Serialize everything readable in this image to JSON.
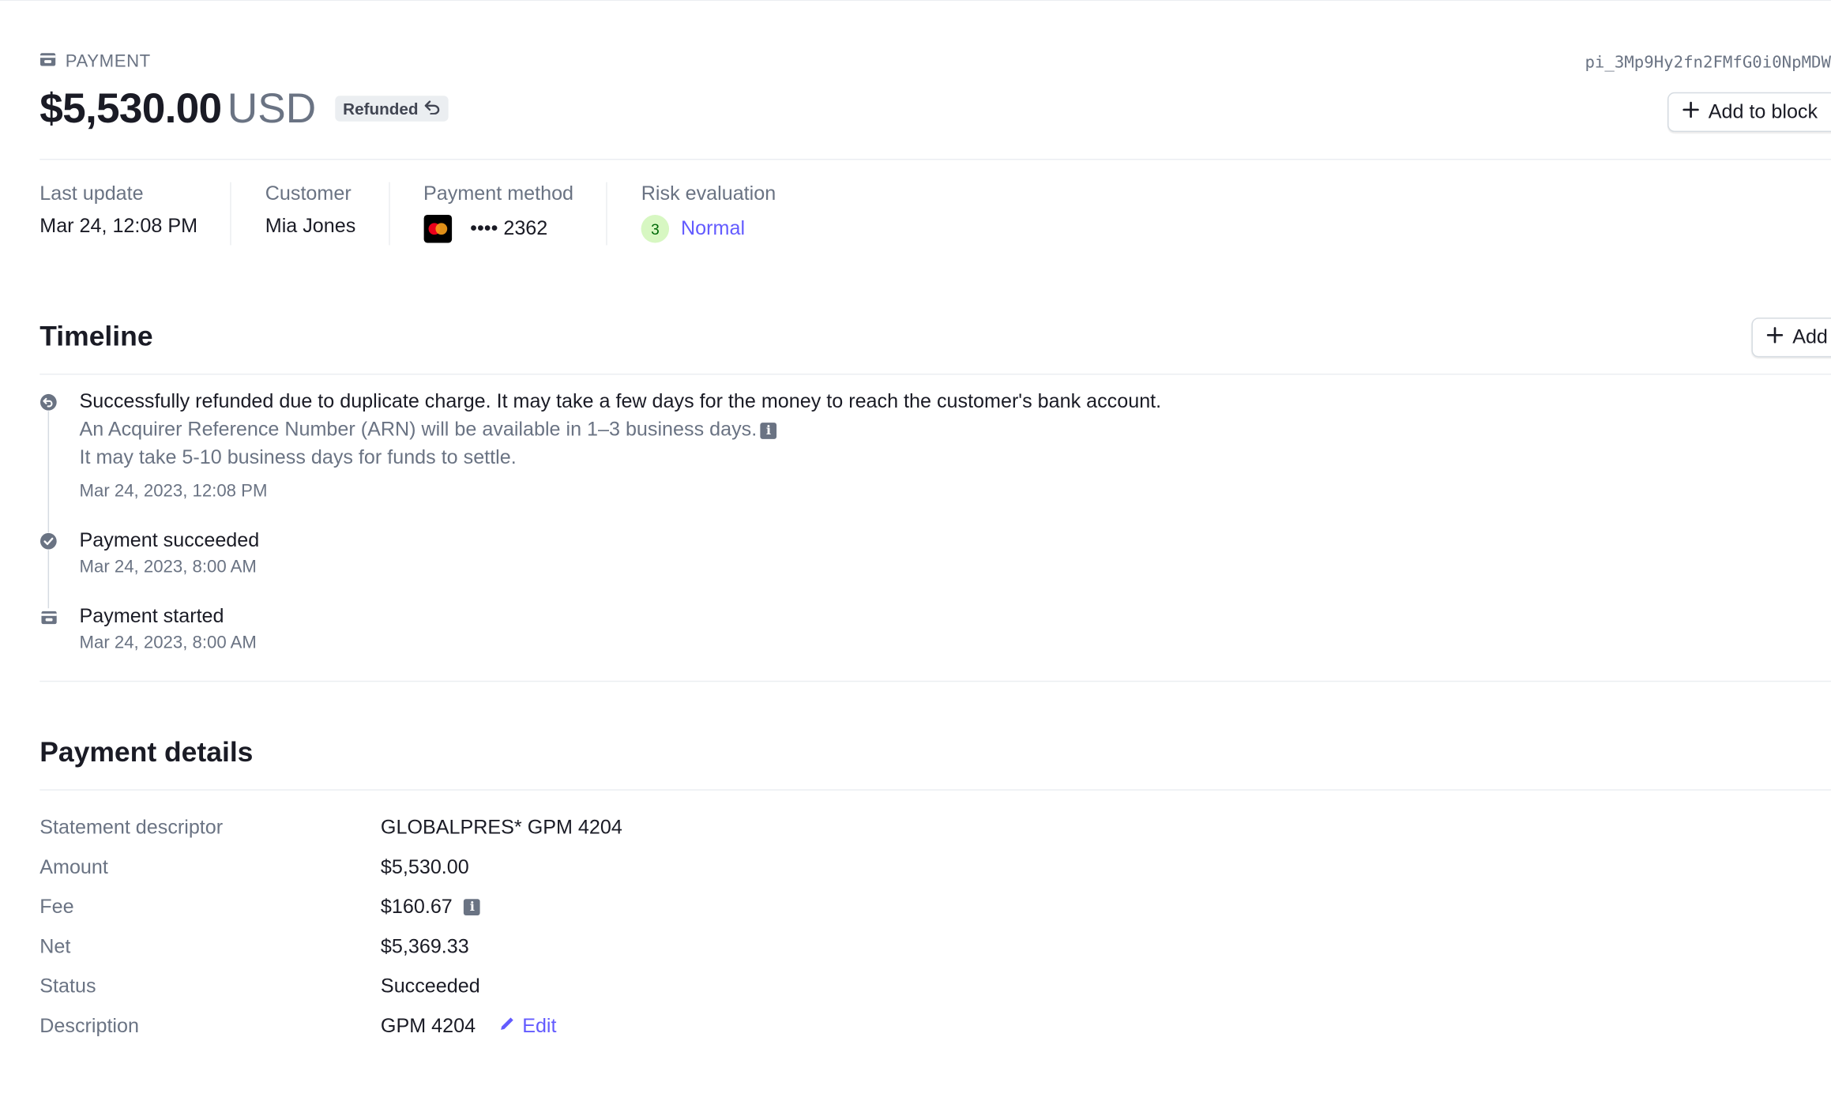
{
  "header": {
    "kicker": "PAYMENT",
    "payment_id": "pi_3Mp9Hy2fn2FMfG0i0NpMDW",
    "amount": "$5,530.00",
    "currency": "USD",
    "status_badge": "Refunded",
    "add_to_block_label": "Add to block"
  },
  "summary": {
    "last_update_label": "Last update",
    "last_update_value": "Mar 24, 12:08 PM",
    "customer_label": "Customer",
    "customer_value": "Mia Jones",
    "payment_method_label": "Payment method",
    "card_masked": "•••• 2362",
    "risk_label": "Risk evaluation",
    "risk_score": "3",
    "risk_value": "Normal"
  },
  "timeline": {
    "title": "Timeline",
    "add_label": "Add",
    "events": [
      {
        "title": "Successfully refunded due to duplicate charge. It may take a few days for the money to reach the customer's bank account.",
        "line2": "An Acquirer Reference Number (ARN) will be available in 1–3 business days.",
        "line3": "It may take 5-10 business days for funds to settle.",
        "date": "Mar 24, 2023, 12:08 PM"
      },
      {
        "title": "Payment succeeded",
        "date": "Mar 24, 2023, 8:00 AM"
      },
      {
        "title": "Payment started",
        "date": "Mar 24, 2023, 8:00 AM"
      }
    ]
  },
  "details": {
    "title": "Payment details",
    "statement_descriptor_label": "Statement descriptor",
    "statement_descriptor_value": "GLOBALPRES* GPM 4204",
    "amount_label": "Amount",
    "amount_value": "$5,530.00",
    "fee_label": "Fee",
    "fee_value": "$160.67",
    "net_label": "Net",
    "net_value": "$5,369.33",
    "status_label": "Status",
    "status_value": "Succeeded",
    "description_label": "Description",
    "description_value": "GPM 4204",
    "edit_label": "Edit"
  },
  "colors": {
    "accent": "#635bff",
    "muted": "#6a7383",
    "text": "#1a1b25",
    "risk_bg": "#d7f7c2"
  }
}
